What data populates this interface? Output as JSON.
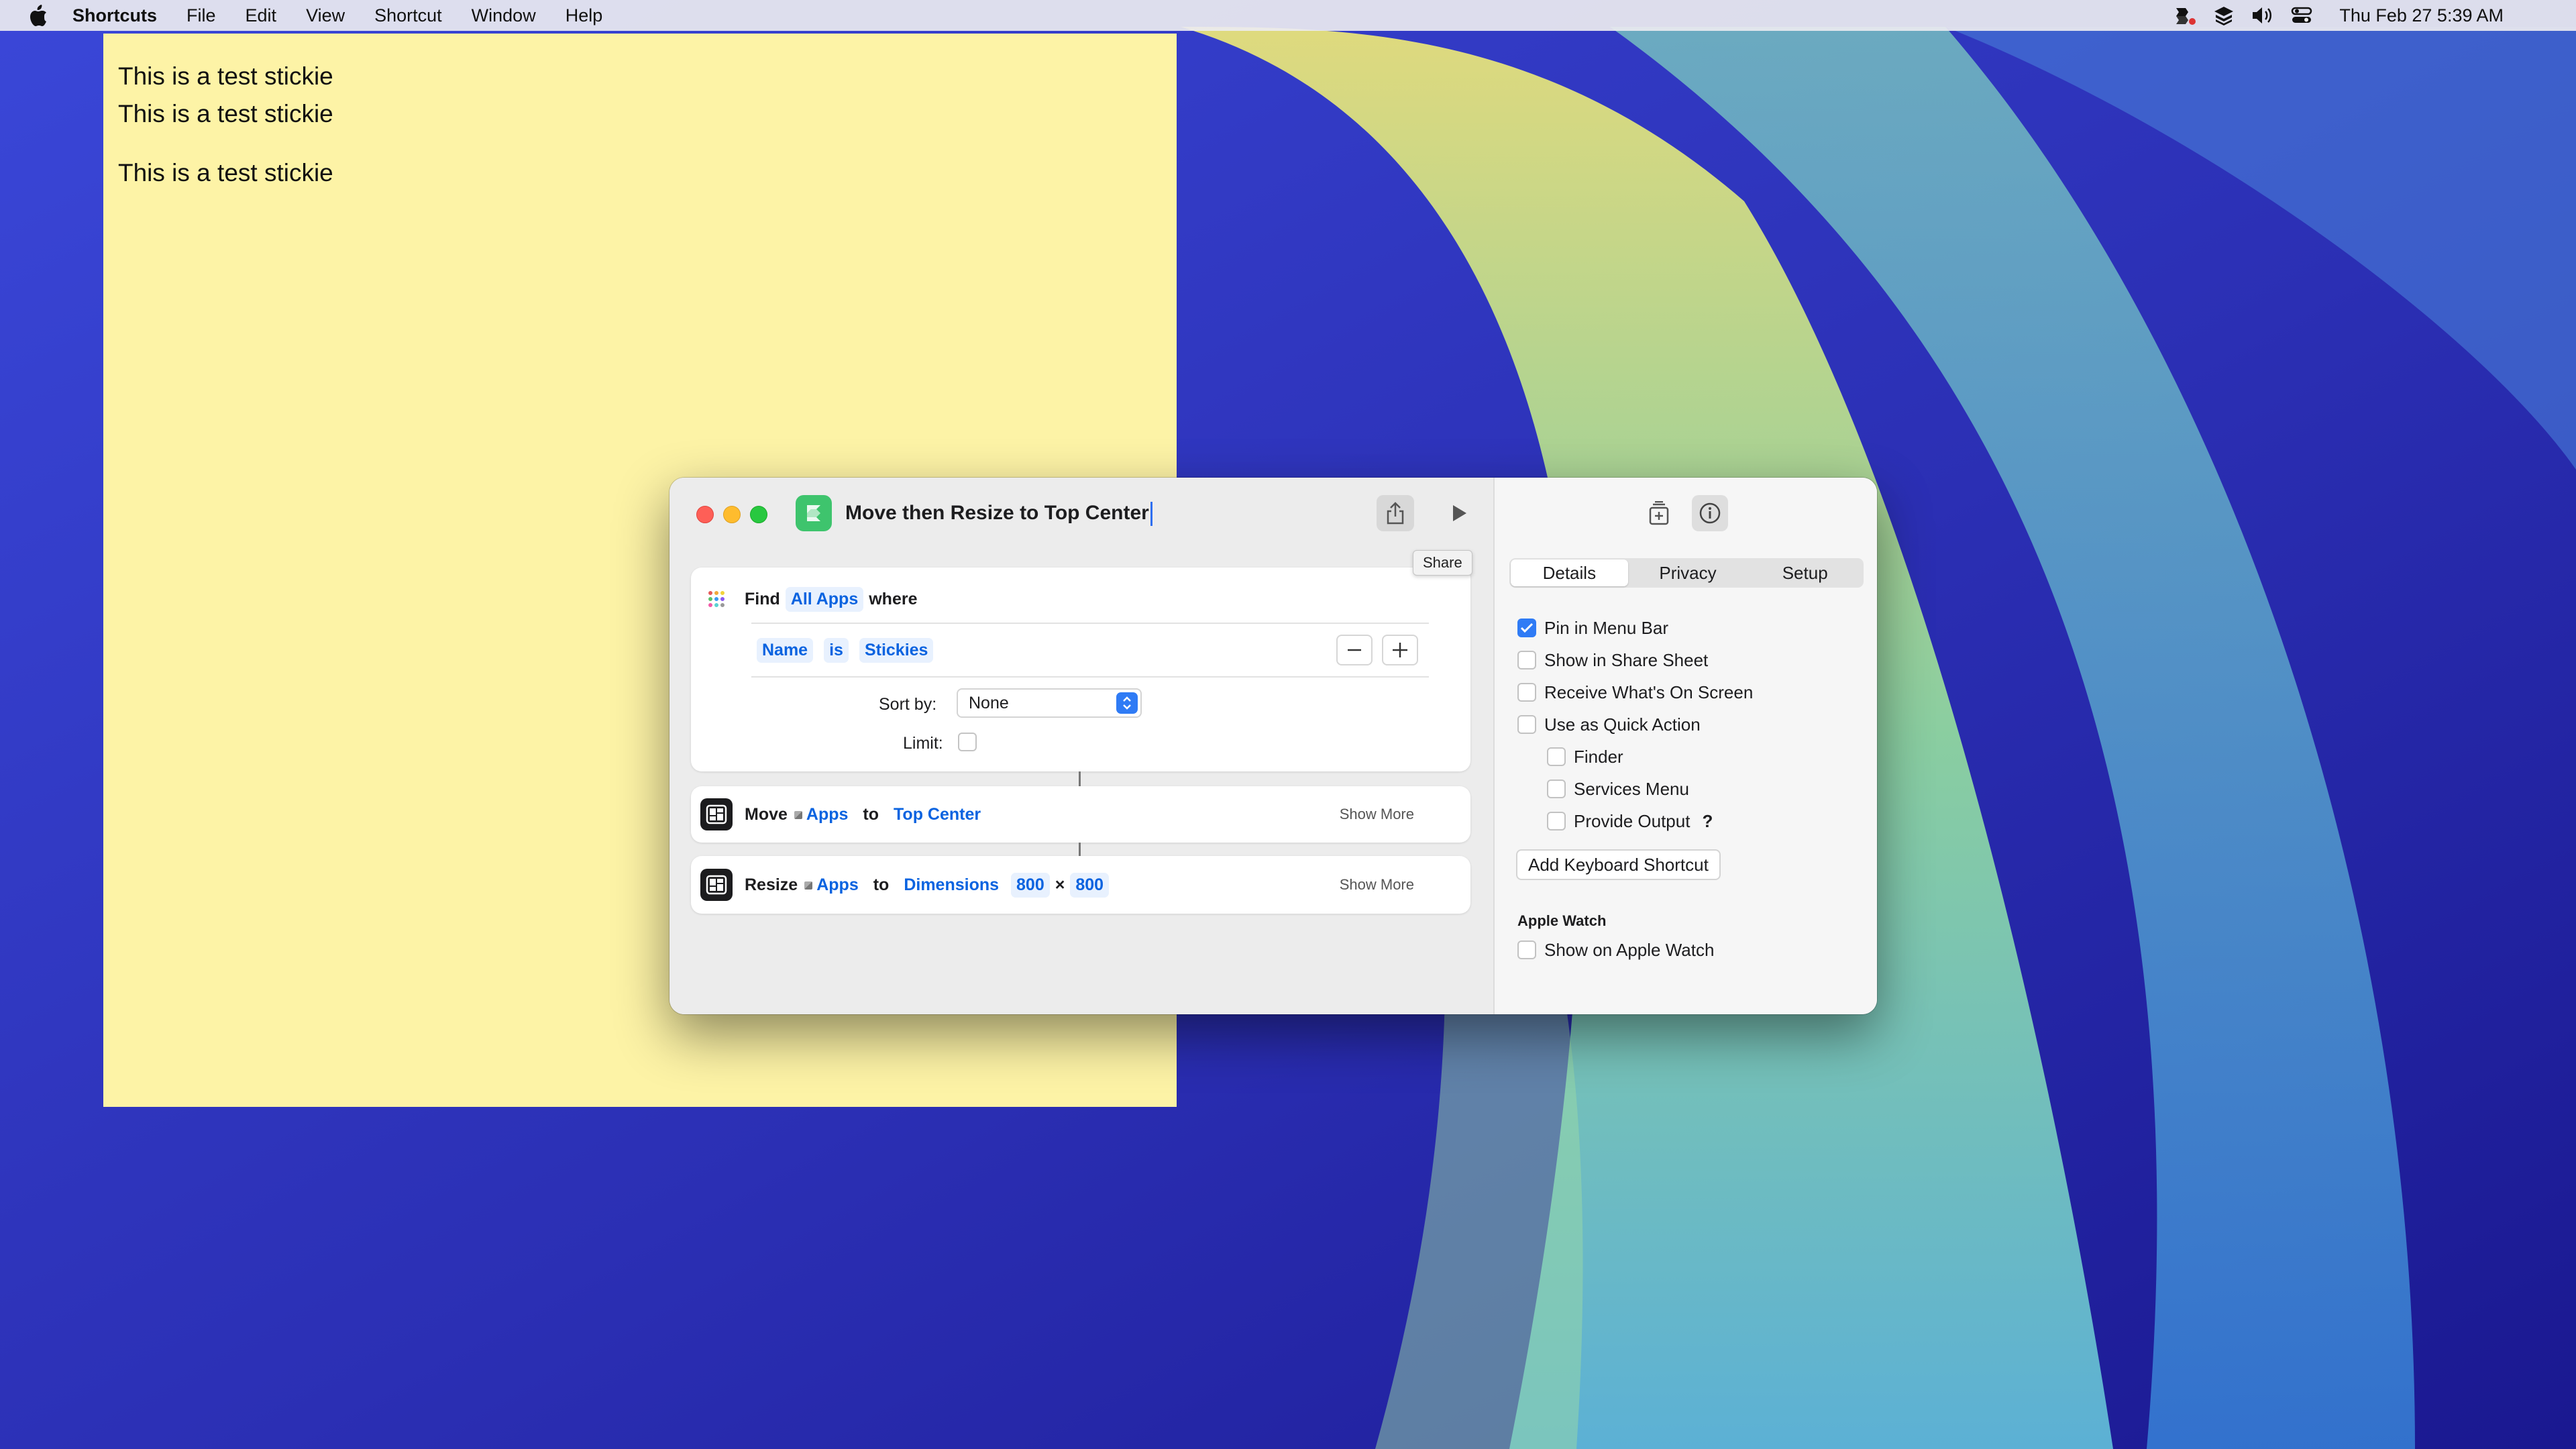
{
  "menubar": {
    "app_name": "Shortcuts",
    "items": [
      "File",
      "Edit",
      "View",
      "Shortcut",
      "Window",
      "Help"
    ],
    "clock": "Thu Feb 27  5:39 AM",
    "status_icons": [
      "shortcuts-status-icon",
      "layers-icon",
      "volume-icon",
      "control-center-icon"
    ]
  },
  "stickie": {
    "lines": [
      "This is a test stickie",
      "This is a test stickie",
      "This is a test stickie"
    ],
    "color": "#fdf3a6"
  },
  "window": {
    "title": "Move then Resize to Top Center",
    "tooltip": "Share",
    "actions": {
      "find": {
        "verb": "Find",
        "scope": "All Apps",
        "suffix": "where",
        "filter": {
          "field": "Name",
          "op": "is",
          "value": "Stickies"
        },
        "sort_label": "Sort by:",
        "sort_value": "None",
        "limit_label": "Limit:"
      },
      "move": {
        "verb": "Move",
        "target": "Apps",
        "to": "to",
        "position": "Top Center",
        "show_more": "Show More"
      },
      "resize": {
        "verb": "Resize",
        "target": "Apps",
        "to": "to",
        "mode": "Dimensions",
        "width": "800",
        "x": "×",
        "height": "800",
        "show_more": "Show More"
      }
    }
  },
  "inspector": {
    "tabs": [
      "Details",
      "Privacy",
      "Setup"
    ],
    "active_tab": "Details",
    "options": [
      {
        "label": "Pin in Menu Bar",
        "checked": true
      },
      {
        "label": "Show in Share Sheet",
        "checked": false
      },
      {
        "label": "Receive What's On Screen",
        "checked": false
      },
      {
        "label": "Use as Quick Action",
        "checked": false
      },
      {
        "label": "Finder",
        "checked": false
      },
      {
        "label": "Services Menu",
        "checked": false
      },
      {
        "label": "Provide Output",
        "checked": false
      }
    ],
    "help": "?",
    "keyboard_button": "Add Keyboard Shortcut",
    "watch_heading": "Apple Watch",
    "watch_option": {
      "label": "Show on Apple Watch",
      "checked": false
    }
  },
  "colors": {
    "accent": "#2f7bf5",
    "token_text": "#0a63e0",
    "shortcut_icon": "#3ec46d"
  }
}
